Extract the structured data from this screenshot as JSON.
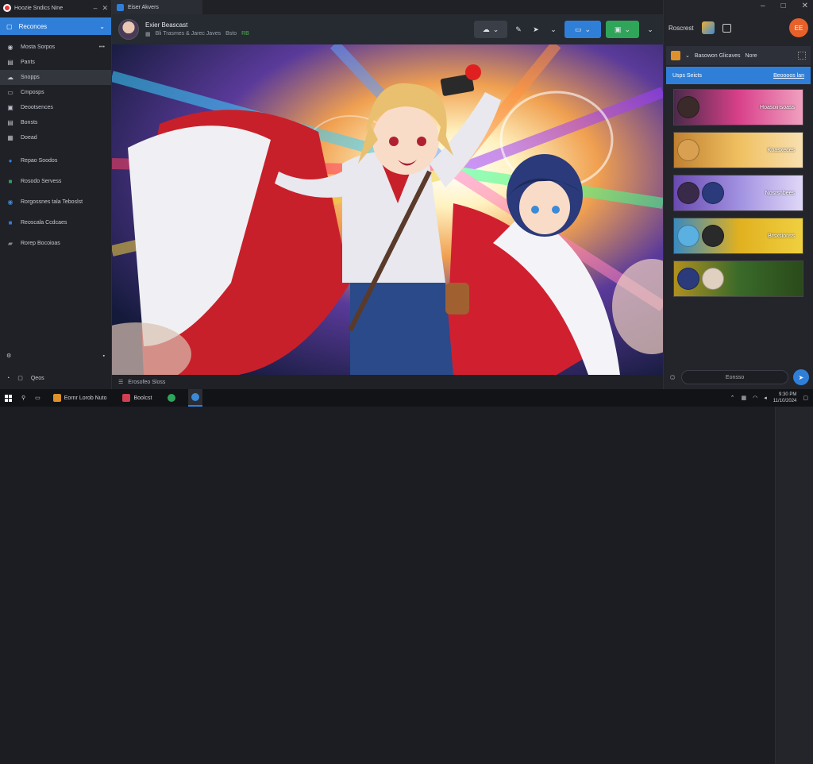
{
  "window": {
    "title": "Hoozie Sndics Nine",
    "tab_title": "Eiser Akvers"
  },
  "sidebar": {
    "active": {
      "label": "Reconces"
    },
    "items": [
      {
        "icon": "chat-icon",
        "label": "Mosta Sorpos"
      },
      {
        "icon": "book-icon",
        "label": "Pants"
      },
      {
        "icon": "cloud-icon",
        "label": "Snopps"
      },
      {
        "icon": "folder-icon",
        "label": "Cmposps"
      },
      {
        "icon": "archive-icon",
        "label": "Deootsences"
      },
      {
        "icon": "save-icon",
        "label": "Bonsts"
      },
      {
        "icon": "image-icon",
        "label": "Doead"
      }
    ],
    "groups": [
      {
        "icon": "globe-icon",
        "label": "Repao Soodos",
        "color": "#2f7fd8"
      },
      {
        "icon": "sheet-icon",
        "label": "Rosodo Servess",
        "color": "#2fa55a"
      },
      {
        "icon": "edge-icon",
        "label": "Rorgossnes tala Teboslst",
        "color": "#3a8ad8"
      },
      {
        "icon": "tile-icon",
        "label": "Reoscala Ccdcaes",
        "color": "#2f7fd8"
      },
      {
        "icon": "folder-icon",
        "label": "Rorep Bocoioas",
        "color": "#888888"
      }
    ],
    "bottom": [
      {
        "icon": "settings-icon",
        "label": ""
      },
      {
        "icon": "help-icon",
        "label": "Qeos"
      }
    ]
  },
  "header": {
    "title": "Exier Beascast",
    "subtitle": "Bli Trasmes & Jarec Javes",
    "status_prefix": "Bsto",
    "status": "RB"
  },
  "right_panel": {
    "title": "Roscrest",
    "avatar_initials": "EE",
    "bar_label": "Basowon Glicaves",
    "bar_tab": "Nore",
    "blue_label": "Usps Seicts",
    "blue_link": "Beoooos lan",
    "thumbs": [
      {
        "label": "Hoasoinsoass",
        "bg": "linear-gradient(90deg,#4a2a4a,#d8408a,#f0a0c0)"
      },
      {
        "label": "Koasxeces",
        "bg": "linear-gradient(90deg,#c08030,#f0c060,#f8e0b0)"
      },
      {
        "label": "Nosrsnbees",
        "bg": "linear-gradient(90deg,#6a4ab0,#a090e0,#e0d8f8)"
      },
      {
        "label": "Brsxsionss",
        "bg": "linear-gradient(90deg,#3a8ac0,#e0b020,#f0d040)"
      },
      {
        "label": "",
        "bg": "linear-gradient(90deg,#b09020,#3a6a2a,#2a4a1a)"
      }
    ],
    "input_placeholder": "Eonsso"
  },
  "footer": {
    "left": "Erosofeo Sloss"
  },
  "taskbar": {
    "apps": [
      {
        "label": "Eornr Lorob Nuto",
        "color": "#e0902a"
      },
      {
        "label": "Boolcst",
        "color": "#d04050"
      },
      {
        "label": "",
        "color": "#2fa55a"
      },
      {
        "label": "",
        "color": "#3a8ad8"
      }
    ],
    "clock_time": "9:30 PM",
    "clock_date": "11/10/2024"
  }
}
